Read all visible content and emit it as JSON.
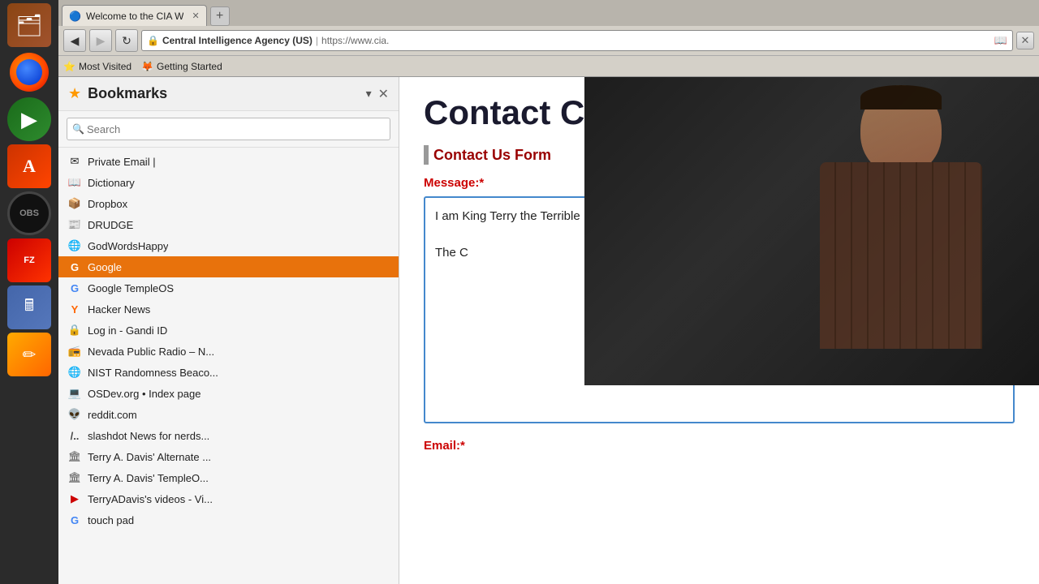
{
  "taskbar": {
    "icons": [
      {
        "name": "files-icon",
        "label": "Files",
        "symbol": "🗂",
        "class": "files"
      },
      {
        "name": "firefox-icon",
        "label": "Firefox",
        "symbol": "firefox",
        "class": "firefox"
      },
      {
        "name": "media-icon",
        "label": "Media Player",
        "symbol": "▶",
        "class": "media"
      },
      {
        "name": "appstore-icon",
        "label": "App Store",
        "symbol": "A",
        "class": "appstore"
      },
      {
        "name": "obs-icon",
        "label": "OBS",
        "symbol": "⏺",
        "class": "obs"
      },
      {
        "name": "filezilla-icon",
        "label": "FileZilla",
        "symbol": "FZ",
        "class": "filezilla"
      },
      {
        "name": "calculator-icon",
        "label": "Calculator",
        "symbol": "🖩",
        "class": "calc"
      },
      {
        "name": "sketch-icon",
        "label": "Sketch",
        "symbol": "✏",
        "class": "sketch"
      }
    ]
  },
  "browser": {
    "tab_title": "Welcome to the CIA W",
    "tab_favicon": "🔒",
    "url_secure_label": "Central Intelligence Agency (US)",
    "url_full": "https://www.cia.",
    "bookmarks_bar": [
      {
        "label": "Most Visited",
        "icon": "⭐"
      },
      {
        "label": "Getting Started",
        "icon": "🦊"
      }
    ]
  },
  "sidebar": {
    "title": "Bookmarks",
    "search_placeholder": "Search",
    "close_label": "✕",
    "bookmarks": [
      {
        "label": "Private Email |",
        "icon": "✉",
        "color": "#555",
        "active": false
      },
      {
        "label": "Dictionary",
        "icon": "📖",
        "color": "#4488cc",
        "active": false
      },
      {
        "label": "Dropbox",
        "icon": "📦",
        "color": "#0060a0",
        "active": false
      },
      {
        "label": "DRUDGE",
        "icon": "📰",
        "color": "#333",
        "active": false
      },
      {
        "label": "GodWordsHappy",
        "icon": "🌐",
        "color": "#4488cc",
        "active": false
      },
      {
        "label": "Google",
        "icon": "G",
        "color": "#4285f4",
        "active": true
      },
      {
        "label": "Google TempleOS",
        "icon": "G",
        "color": "#4285f4",
        "active": false
      },
      {
        "label": "Hacker News",
        "icon": "Y",
        "color": "#ff6600",
        "active": false
      },
      {
        "label": "Log in - Gandi ID",
        "icon": "🔒",
        "color": "#555",
        "active": false
      },
      {
        "label": "Nevada Public Radio – N...",
        "icon": "📻",
        "color": "#333",
        "active": false
      },
      {
        "label": "NIST Randomness Beaco...",
        "icon": "🌐",
        "color": "#4488cc",
        "active": false
      },
      {
        "label": "OSDev.org • Index page",
        "icon": "💻",
        "color": "#4488cc",
        "active": false
      },
      {
        "label": "reddit.com",
        "icon": "👽",
        "color": "#ff4500",
        "active": false
      },
      {
        "label": "slashdot News for nerds...",
        "icon": ".",
        "color": "#444",
        "active": false
      },
      {
        "label": "Terry A. Davis' Alternate ...",
        "icon": "🏛",
        "color": "#555",
        "active": false
      },
      {
        "label": "Terry A. Davis' TempleO...",
        "icon": "🏛",
        "color": "#555",
        "active": false
      },
      {
        "label": "TerryADavis's videos - Vi...",
        "icon": "▶",
        "color": "#cc0000",
        "active": false
      },
      {
        "label": "touch pad",
        "icon": "G",
        "color": "#4285f4",
        "active": false
      }
    ]
  },
  "cia_page": {
    "title": "Contact CIA",
    "section_title": "Contact Us Form",
    "message_label": "Message:",
    "message_required": "*",
    "message_line1": "I am King Terry the Terrible",
    "message_line2": "The C",
    "email_label": "Email:",
    "email_required": "*"
  }
}
